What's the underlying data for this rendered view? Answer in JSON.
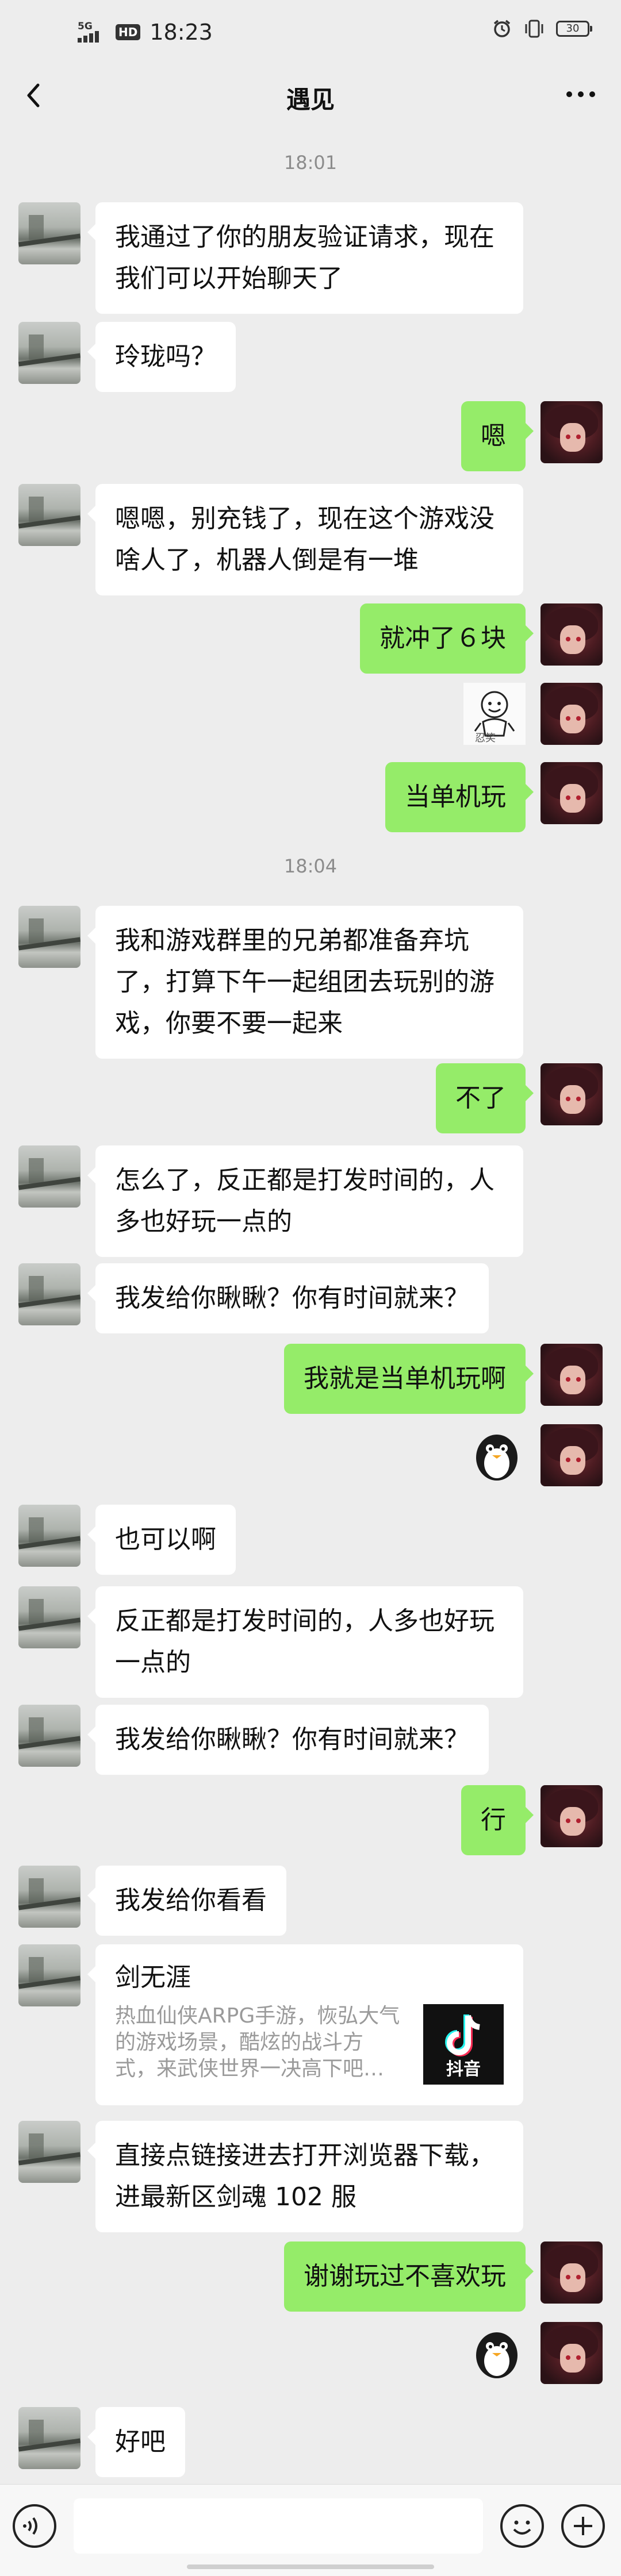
{
  "status_bar": {
    "network": "5G",
    "hd_badge": "HD",
    "time": "18:23",
    "battery": "30",
    "icons": [
      "signal-icon",
      "alarm-icon",
      "vibrate-icon",
      "battery-icon"
    ]
  },
  "navbar": {
    "title": "遇见",
    "icons": [
      "back-chevron-icon",
      "more-dots-icon"
    ]
  },
  "colors": {
    "background": "#ededed",
    "incoming_bubble": "#ffffff",
    "outgoing_bubble": "#95ec69",
    "timestamp": "#8c8c8c"
  },
  "chat": {
    "time_1": "18:01",
    "time_2": "18:04",
    "m01": "我通过了你的朋友验证请求，现在我们可以开始聊天了",
    "m02": "玲珑吗？",
    "m03": "嗯",
    "m04": "嗯嗯，别充钱了，现在这个游戏没啥人了，机器人倒是有一堆",
    "m05": "就冲了６块",
    "m06_sticker_caption": "忍笑",
    "m07": "当单机玩",
    "m08": "我和游戏群里的兄弟都准备弃坑了，打算下午一起组团去玩别的游戏，你要不要一起来",
    "m09": "不了",
    "m10": "怎么了，反正都是打发时间的，人多也好玩一点的",
    "m11": "我发给你瞅瞅？你有时间就来？",
    "m12": "我就是当单机玩啊",
    "m13_sticker": "penguin-sticker",
    "m14": "也可以啊",
    "m15": "反正都是打发时间的，人多也好玩一点的",
    "m16": "我发给你瞅瞅？你有时间就来？",
    "m17": "行",
    "m18": "我发给你看看",
    "m19_card": {
      "title": "剑无涯",
      "desc": "热血仙侠ARPG手游，恢弘大气的游戏场景，酷炫的战斗方式，来武侠世界一决高下吧…",
      "source": "抖音"
    },
    "m20": "直接点链接进去打开浏览器下载，进最新区剑魂 102 服",
    "m21": "谢谢玩过不喜欢玩",
    "m22_sticker": "penguin-sticker",
    "m23": "好吧"
  },
  "input_bar": {
    "value": "",
    "icons": [
      "voice-icon",
      "emoji-icon",
      "plus-icon"
    ]
  }
}
